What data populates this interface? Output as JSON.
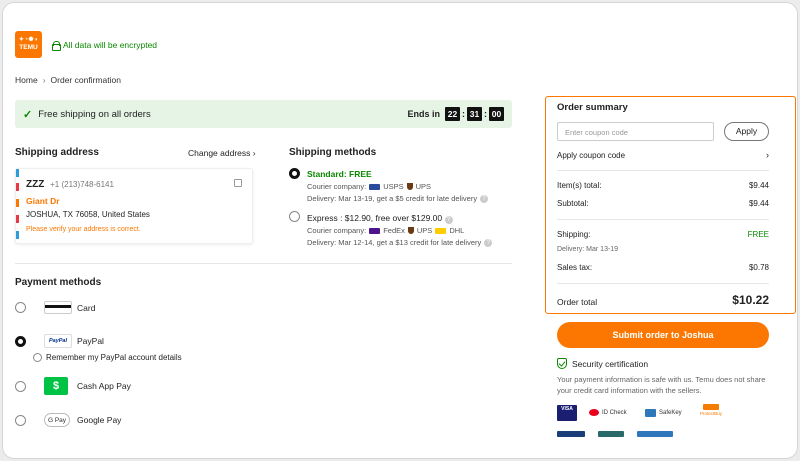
{
  "header": {
    "logo_text": "TEMU",
    "encrypt_text": "All data will be encrypted"
  },
  "breadcrumb": {
    "home": "Home",
    "separator": "›",
    "current": "Order confirmation"
  },
  "banner": {
    "text": "Free shipping on all orders",
    "ends_label": "Ends in",
    "timer": {
      "hours": "22",
      "minutes": "31",
      "seconds": "00"
    }
  },
  "shipping_address": {
    "heading": "Shipping address",
    "change_label": "Change address ›",
    "name": "ZZZ",
    "phone": "+1 (213)748-6141",
    "street": "Giant Dr",
    "city": "JOSHUA, TX 76058, United States",
    "warning": "Please verify your address is correct."
  },
  "shipping_methods": {
    "heading": "Shipping methods",
    "standard": {
      "title": "Standard: FREE",
      "courier_label": "Courier company:",
      "couriers": [
        "USPS",
        "UPS"
      ],
      "delivery": "Delivery: Mar 13-19, get a $5 credit for late delivery"
    },
    "express": {
      "title": "Express : $12.90, free over $129.00",
      "courier_label": "Courier company:",
      "couriers": [
        "FedEx",
        "UPS",
        "DHL"
      ],
      "delivery": "Delivery: Mar 12-14, get a $13 credit for late delivery"
    }
  },
  "payment_methods": {
    "heading": "Payment methods",
    "card": "Card",
    "paypal": "PayPal",
    "paypal_logo": "PayPal",
    "remember_paypal": "Remember my PayPal account details",
    "cashapp": "Cash App Pay",
    "gpay": "Google Pay",
    "gpay_logo": "G Pay"
  },
  "order_summary": {
    "title": "Order summary",
    "coupon_placeholder": "Enter coupon code",
    "apply_button": "Apply",
    "apply_coupon_link": "Apply coupon code",
    "items_total_label": "Item(s) total:",
    "items_total": "$9.44",
    "subtotal_label": "Subtotal:",
    "subtotal": "$9.44",
    "shipping_label": "Shipping:",
    "shipping_value": "FREE",
    "shipping_delivery": "Delivery: Mar 13-19",
    "sales_tax_label": "Sales tax:",
    "sales_tax": "$0.78",
    "order_total_label": "Order total",
    "order_total": "$10.22"
  },
  "submit_button": "Submit order to Joshua",
  "security": {
    "title": "Security certification",
    "description": "Your payment information is safe with us. Temu does not share your credit card information with the sellers."
  },
  "trust_badges": {
    "visa": "VISA",
    "id_check": "ID Check",
    "safekey": "SafeKey",
    "protectbuy": "ProtectBuy"
  },
  "colors": {
    "brand": "#fb7701",
    "success": "#0a8800"
  }
}
